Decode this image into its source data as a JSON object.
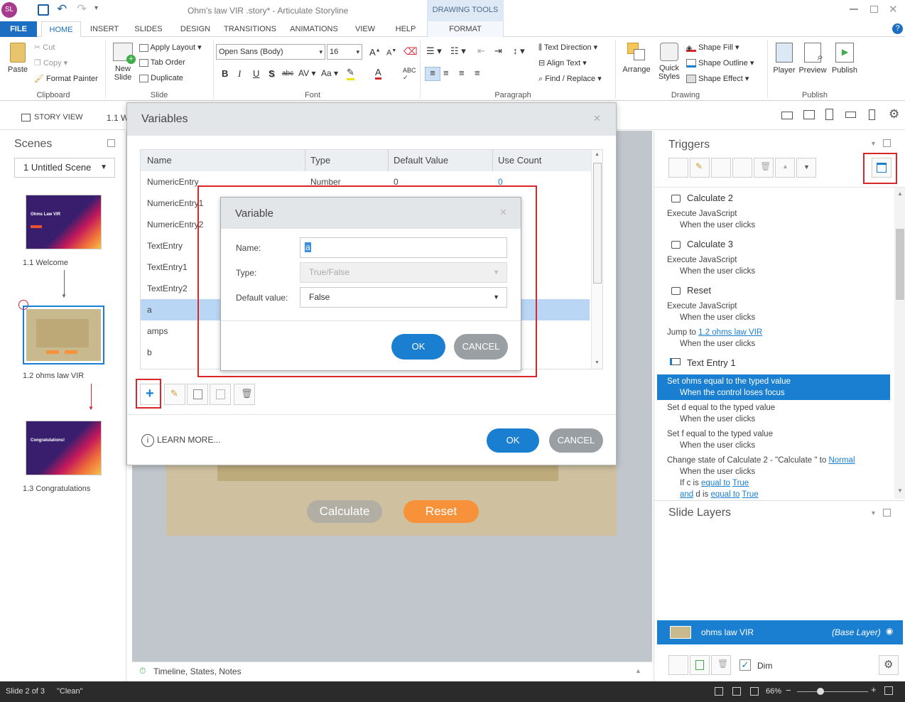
{
  "app": {
    "title": "Ohm's law VIR .story* - Articulate Storyline",
    "logo": "SL"
  },
  "contextual": {
    "group_label": "DRAWING TOOLS",
    "tab": "FORMAT"
  },
  "tabs": [
    "FILE",
    "HOME",
    "INSERT",
    "SLIDES",
    "DESIGN",
    "TRANSITIONS",
    "ANIMATIONS",
    "VIEW",
    "HELP"
  ],
  "ribbon": {
    "clipboard": {
      "paste": "Paste",
      "cut": "Cut",
      "copy": "Copy",
      "format_painter": "Format Painter",
      "label": "Clipboard"
    },
    "slide": {
      "new_slide": "New Slide",
      "apply_layout": "Apply Layout",
      "tab_order": "Tab Order",
      "duplicate": "Duplicate",
      "label": "Slide"
    },
    "font": {
      "family": "Open Sans (Body)",
      "size": "16",
      "bold": "B",
      "italic": "I",
      "underline": "U",
      "shadow": "S",
      "strike": "abc",
      "label": "Font"
    },
    "paragraph": {
      "text_direction": "Text Direction",
      "align_text": "Align Text",
      "find_replace": "Find / Replace",
      "label": "Paragraph"
    },
    "drawing": {
      "arrange": "Arrange",
      "quick_styles": "Quick Styles",
      "shape_fill": "Shape Fill",
      "shape_outline": "Shape Outline",
      "shape_effect": "Shape Effect",
      "label": "Drawing"
    },
    "publish": {
      "player": "Player",
      "preview": "Preview",
      "publish": "Publish",
      "label": "Publish"
    }
  },
  "viewbar": {
    "story_view": "STORY VIEW",
    "slide_tab": "1.1 W"
  },
  "scenes": {
    "title": "Scenes",
    "dropdown": "1 Untitled Scene",
    "slides": [
      {
        "label": "1.1 Welcome",
        "thumb_title": "Ohms Law VIR"
      },
      {
        "label": "1.2 ohms law VIR"
      },
      {
        "label": "1.3 Congratulations",
        "thumb_title": "Congratulations!"
      }
    ]
  },
  "canvas": {
    "calculate": "Calculate",
    "reset": "Reset"
  },
  "timeline": {
    "label": "Timeline, States, Notes"
  },
  "variables_dialog": {
    "title": "Variables",
    "columns": [
      "Name",
      "Type",
      "Default Value",
      "Use Count"
    ],
    "rows": [
      {
        "name": "NumericEntry",
        "type": "Number",
        "default": "0",
        "count": "0"
      },
      {
        "name": "NumericEntry1",
        "type": "",
        "default": "",
        "count": ""
      },
      {
        "name": "NumericEntry2",
        "type": "",
        "default": "",
        "count": ""
      },
      {
        "name": "TextEntry",
        "type": "",
        "default": "",
        "count": ""
      },
      {
        "name": "TextEntry1",
        "type": "",
        "default": "",
        "count": ""
      },
      {
        "name": "TextEntry2",
        "type": "",
        "default": "",
        "count": ""
      },
      {
        "name": "a",
        "type": "",
        "default": "",
        "count": ""
      },
      {
        "name": "amps",
        "type": "",
        "default": "",
        "count": ""
      },
      {
        "name": "b",
        "type": "",
        "default": "",
        "count": ""
      }
    ],
    "learn_more": "LEARN MORE...",
    "ok": "OK",
    "cancel": "CANCEL"
  },
  "variable_dialog": {
    "title": "Variable",
    "name_label": "Name:",
    "name_value": "a",
    "type_label": "Type:",
    "type_value": "True/False",
    "default_label": "Default value:",
    "default_value": "False",
    "ok": "OK",
    "cancel": "CANCEL"
  },
  "triggers": {
    "title": "Triggers",
    "groups": [
      {
        "title": "Calculate 2",
        "lines": [
          [
            "Execute JavaScript",
            ""
          ],
          [
            "When the user clicks",
            ""
          ]
        ]
      },
      {
        "title": "Calculate 3",
        "lines": [
          [
            "Execute JavaScript",
            ""
          ],
          [
            "When the user clicks",
            ""
          ]
        ]
      },
      {
        "title": "Reset",
        "lines": [
          [
            "Execute JavaScript",
            ""
          ],
          [
            "When the user clicks",
            ""
          ],
          [
            "Jump to ",
            "1.2 ohms law VIR"
          ],
          [
            "When the user clicks",
            ""
          ]
        ]
      },
      {
        "title": "Text Entry 1",
        "lines": []
      }
    ],
    "selected": {
      "line1": "Set ohms equal to the typed value",
      "line2": "When the control loses focus"
    },
    "after": {
      "d1": "Set d equal to the typed value",
      "d2": "When the user clicks",
      "f1": "Set f equal to the typed value",
      "f2": "When the user clicks",
      "c1": "Change state of Calculate 2 - \"Calculate \" to ",
      "c1_link": "Normal",
      "c2": "When the user clicks",
      "c3a": "If c is ",
      "c3b": "equal to",
      "c3c": "True",
      "c4a": "and",
      "c4b": " d is ",
      "c4c": "equal to",
      "c4d": "True"
    }
  },
  "layers": {
    "title": "Slide Layers",
    "base_name": "ohms law VIR",
    "base_tag": "(Base Layer)",
    "dim": "Dim"
  },
  "status": {
    "slide": "Slide 2 of 3",
    "theme": "\"Clean\"",
    "zoom": "66%"
  },
  "colors": {
    "accent": "#1a7fd1",
    "selection": "#1a7fd1",
    "highlight_red": "#d9262a",
    "reset_orange": "#f7923a"
  }
}
